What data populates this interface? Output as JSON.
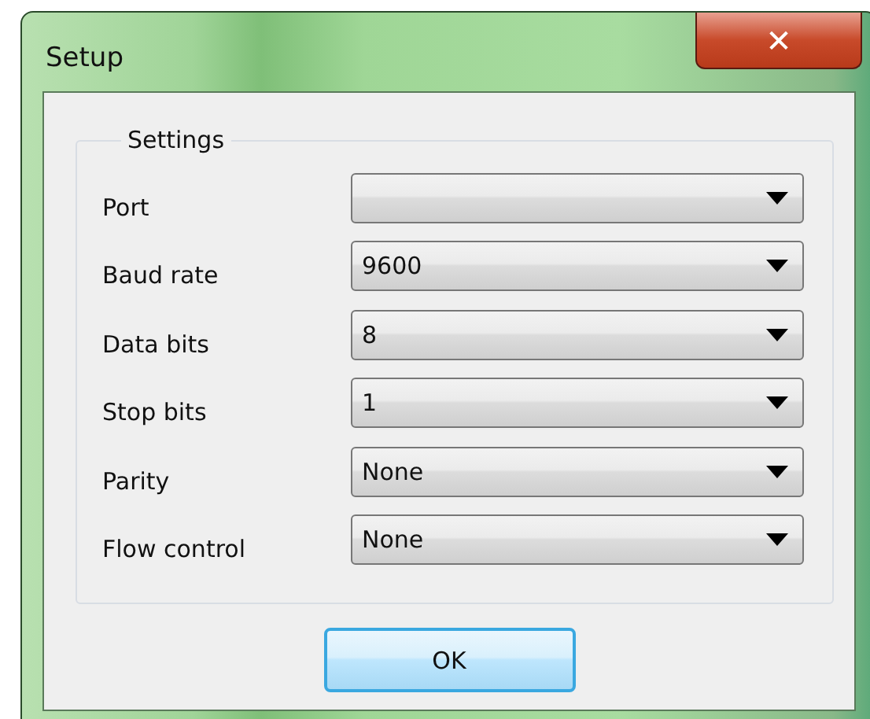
{
  "window": {
    "title": "Setup",
    "close": "✕"
  },
  "group": {
    "title": "Settings",
    "fields": [
      {
        "label": "Port"
      },
      {
        "label": "Baud rate",
        "value": "9600"
      },
      {
        "label": "Data bits",
        "value": "8"
      },
      {
        "label": "Stop bits",
        "value": "1"
      },
      {
        "label": "Parity",
        "value": "None"
      },
      {
        "label": "Flow control",
        "value": "None"
      }
    ]
  },
  "buttons": [
    "OK"
  ]
}
